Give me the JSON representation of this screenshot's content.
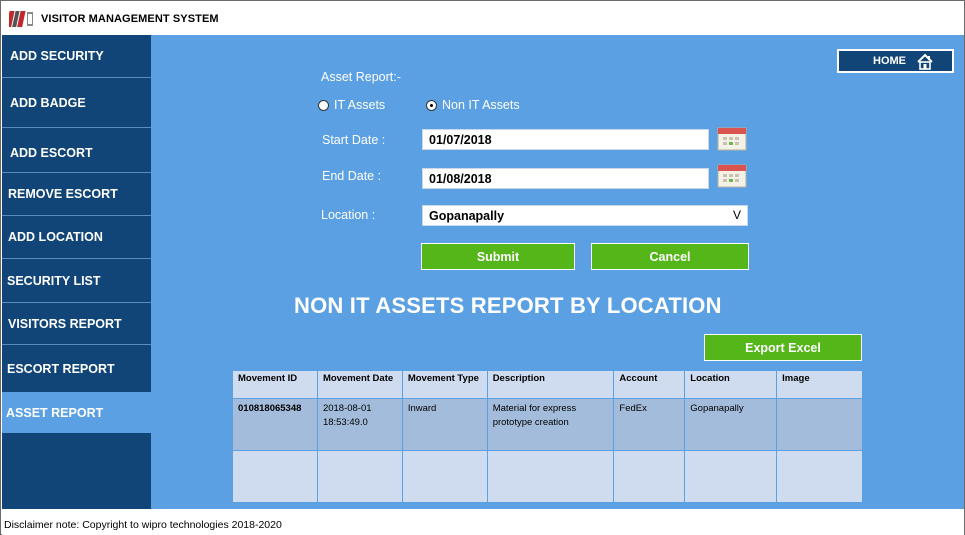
{
  "app": {
    "title": "VISITOR MANAGEMENT SYSTEM"
  },
  "sidebar": {
    "items": [
      {
        "label": "ADD SECURITY"
      },
      {
        "label": "ADD BADGE"
      },
      {
        "label": "ADD ESCORT"
      },
      {
        "label": "REMOVE ESCORT"
      },
      {
        "label": "ADD LOCATION"
      },
      {
        "label": "SECURITY LIST"
      },
      {
        "label": "VISITORS REPORT"
      },
      {
        "label": "ESCORT REPORT"
      },
      {
        "label": "ASSET REPORT"
      }
    ],
    "active": "ASSET REPORT"
  },
  "header": {
    "home_label": "HOME"
  },
  "form": {
    "heading": "Asset Report:-",
    "radio_it": "IT Assets",
    "radio_non_it": "Non IT Assets",
    "selected_radio": "Non IT Assets",
    "start_label": "Start Date :",
    "start_value": "01/07/2018",
    "end_label": "End Date :",
    "end_value": "01/08/2018",
    "location_label": "Location :",
    "location_value": "Gopanapally",
    "submit_label": "Submit",
    "cancel_label": "Cancel"
  },
  "report": {
    "title": "NON IT ASSETS REPORT BY LOCATION",
    "export_label": "Export Excel",
    "columns": [
      "Movement ID",
      "Movement Date",
      "Movement Type",
      "Description",
      "Account",
      "Location",
      "Image"
    ],
    "rows": [
      {
        "movement_id": "010818065348",
        "movement_date": "2018-08-01 18:53:49.0",
        "movement_type": "Inward",
        "description": "Material for express prototype creation",
        "account": "FedEx",
        "location": "Gopanapally",
        "image": ""
      }
    ]
  },
  "footer": {
    "disclaimer": "Disclaimer note: Copyright to wipro technologies 2018-2020"
  },
  "colors": {
    "sidebar": "#114577",
    "main": "#5ba0e3",
    "button_green": "#55b61a",
    "table_header": "#cfdcf0",
    "table_row": "#a3bcdc"
  },
  "icons": {
    "logo": "app-logo-icon",
    "home": "home-icon",
    "calendar": "calendar-icon",
    "dropdown": "chevron-down-icon"
  }
}
